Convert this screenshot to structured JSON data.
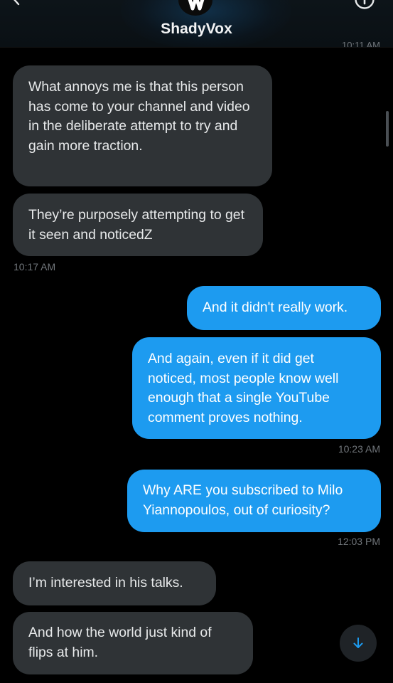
{
  "header": {
    "title": "ShadyVox",
    "previous_timestamp": "10:11 AM",
    "icons": [
      "back-arrow-icon",
      "avatar-logo-icon",
      "info-icon"
    ]
  },
  "messages": [
    {
      "side": "in",
      "text": "What annoys me is that this person has come to your channel and video in the deliberate attempt to try and gain more traction."
    },
    {
      "side": "in",
      "text": "They’re purposely attempting to get it seen and noticedZ",
      "time": "10:17 AM"
    },
    {
      "side": "out",
      "text": "And it didn't really work."
    },
    {
      "side": "out",
      "text": "And again, even if it did get noticed, most people know well enough that a single YouTube comment proves nothing.",
      "time": "10:23 AM"
    },
    {
      "side": "out",
      "text": "Why ARE you subscribed to Milo Yiannopoulos, out of curiosity?",
      "time": "12:03 PM"
    },
    {
      "side": "in",
      "text": "I’m interested in his talks."
    },
    {
      "side": "in",
      "text": "And how the world just kind of flips at him."
    }
  ],
  "controls": {
    "scroll_down_icon": "arrow-down-icon"
  },
  "colors": {
    "background": "#000000",
    "incoming_bubble": "#2f3336",
    "outgoing_bubble": "#1d9bf0",
    "timestamp": "#71767b",
    "text": "#e7e9ea"
  }
}
